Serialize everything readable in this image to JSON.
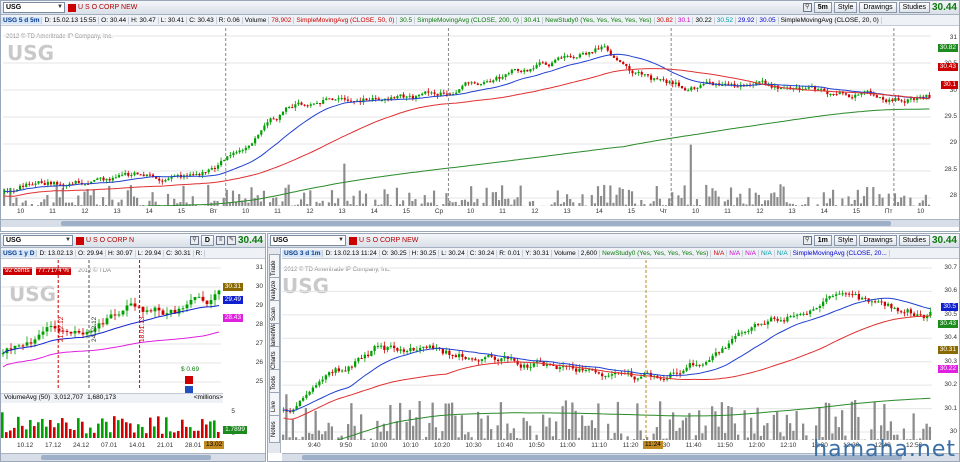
{
  "top": {
    "symbol": "USG",
    "company": "U S O CORP NEW",
    "period_btn": "5m",
    "style_btn": "Style",
    "drawings_btn": "Drawings",
    "studies_btn": "Studies",
    "last_price": "30.44",
    "info": [
      "USG 5 d 5m",
      "D: 15.02.13 15:55",
      "O: 30.44",
      "H: 30.47",
      "L: 30.41",
      "C: 30.43",
      "R: 0.06",
      "Volume",
      "78,902",
      "SimpleMovingAvg (CLOSE, 50, 0)",
      "30.5",
      "SimpleMovingAvg (CLOSE, 200, 0)",
      "30.41",
      "NewStudy0 (Yes, Yes, Yes, Yes, Yes)",
      "30.82",
      "30.1",
      "30.22",
      "30.52",
      "29.92",
      "30.05",
      "SimpleMovingAvg (CLOSE, 20, 0)"
    ],
    "watermark": "USG",
    "copyright": "2012 © TD Ameritrade IP Company, Inc.",
    "y_ticks": [
      "31",
      "30.5",
      "30",
      "29.5",
      "29",
      "28.5",
      "28"
    ],
    "x_ticks": [
      "10",
      "11",
      "12",
      "13",
      "14",
      "15",
      "Вт",
      "10",
      "11",
      "12",
      "13",
      "14",
      "15",
      "Ср",
      "10",
      "11",
      "12",
      "13",
      "14",
      "15",
      "Чт",
      "10",
      "11",
      "12",
      "13",
      "14",
      "15",
      "Пт",
      "10"
    ],
    "tags": {
      "t1": "30.82",
      "t2": "30.43",
      "t3": "30.1"
    },
    "colors": {
      "up": "#00a000",
      "down": "#d00000",
      "sma50": "#e03030",
      "sma200": "#2a8a2a",
      "sma20": "#2040d0",
      "volume": "#8c8c8c"
    }
  },
  "bottom_left": {
    "symbol": "USG",
    "company": "U S O CORP N",
    "period_btn": "D",
    "last_price": "30.44",
    "info": [
      "USG 1 y D",
      "D: 13.02.13",
      "O: 29.94",
      "H: 30.97",
      "L: 29.94",
      "C: 30.31",
      "R:"
    ],
    "badge_cents": "92 cents",
    "badge_pct": "77.7174 %",
    "watermark": "USG",
    "copyright": "2012 © TDA",
    "y_ticks": [
      "31",
      "30",
      "29",
      "28",
      "27",
      "26",
      "25"
    ],
    "vol_ticks": [
      "5",
      "0"
    ],
    "tags": {
      "p1": "30.31",
      "p2": "29.49",
      "p3": "28.43",
      "vol": "1.7899"
    },
    "vert_labels": [
      "21.12.12",
      "24.12.12",
      "18.01.13"
    ],
    "eps_label": "$ 0.69",
    "volume_label": "VolumeAvg (50)",
    "volume_v1": "3,012,707",
    "volume_v2": "1,680,173",
    "millions": "<millions>",
    "x_ticks": [
      "10.12",
      "17.12",
      "24.12",
      "07.01",
      "14.01",
      "21.01",
      "28.01"
    ],
    "x_highlight": "13.02"
  },
  "bottom_right": {
    "symbol": "USG",
    "company": "U S O CORP NEW",
    "period_btn": "1m",
    "style_btn": "Style",
    "drawings_btn": "Drawings",
    "studies_btn": "Studies",
    "last_price": "30.44",
    "info": [
      "USG 3 d 1m",
      "D: 13.02.13 11:24",
      "O: 30.25",
      "H: 30.25",
      "L: 30.24",
      "C: 30.24",
      "R: 0.01",
      "Y: 30.31",
      "Volume",
      "2,600",
      "NewStudy0 (Yes, Yes, Yes, Yes, Yes)",
      "N/A",
      "N/A",
      "N/A",
      "N/A",
      "N/A",
      "SimpleMovingAvg (CLOSE, 20..."
    ],
    "side_tabs": [
      "Trade",
      "Analyze",
      "Scan",
      "MarketWatch",
      "Charts",
      "Tools",
      "Live",
      "Notes"
    ],
    "watermark": "USG",
    "copyright": "2012 © TD Ameritrade IP Company, Inc.",
    "y_ticks": [
      "30.7",
      "30.6",
      "30.5",
      "30.4",
      "30.3",
      "30.2",
      "30.1",
      "30"
    ],
    "tags": {
      "b1": "30.5",
      "b2": "30.43",
      "b3": "30.31",
      "b4": "30.22"
    },
    "x_ticks": [
      "9:40",
      "9:50",
      "10:00",
      "10:10",
      "10:20",
      "10:30",
      "10:40",
      "10:50",
      "11:00",
      "11:10",
      "11:20",
      "11:30",
      "11:40",
      "11:50",
      "12:00",
      "12:10",
      "12:20",
      "12:30",
      "12:40",
      "12:50"
    ],
    "x_highlight": "11:24"
  },
  "site": "hamaha.net"
}
